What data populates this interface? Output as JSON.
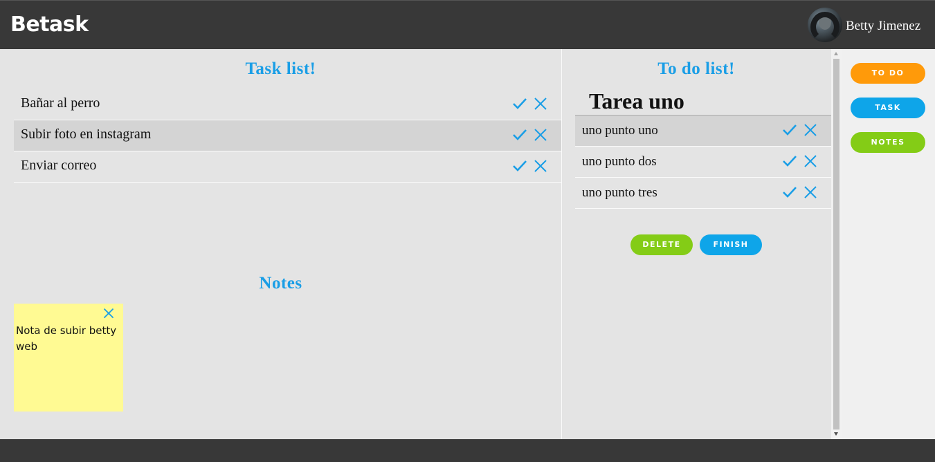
{
  "header": {
    "logo": "Betask",
    "username": "Betty Jimenez"
  },
  "task_section": {
    "title": "Task list!",
    "tasks": [
      {
        "label": "Bañar al perro"
      },
      {
        "label": "Subir foto en instagram"
      },
      {
        "label": "Enviar correo"
      }
    ]
  },
  "notes_section": {
    "title": "Notes",
    "notes": [
      {
        "text": "Nota de subir betty web"
      }
    ]
  },
  "todo_section": {
    "title": "To do list!",
    "heading": "Tarea uno",
    "items": [
      {
        "label": "uno punto uno"
      },
      {
        "label": "uno punto dos"
      },
      {
        "label": "uno punto tres"
      }
    ],
    "delete_label": "DELETE",
    "finish_label": "FINISH"
  },
  "sidebar": {
    "buttons": [
      {
        "label": "TO DO",
        "color": "#ff9a0a"
      },
      {
        "label": "TASK",
        "color": "#0ea5e9"
      },
      {
        "label": "NOTES",
        "color": "#84cc16"
      }
    ]
  },
  "colors": {
    "accent_blue": "#1a9ee6",
    "green": "#84cc16",
    "orange": "#ff9a0a",
    "note_yellow": "#fffa93"
  },
  "icons": {
    "check": "check-icon",
    "close": "close-icon"
  }
}
